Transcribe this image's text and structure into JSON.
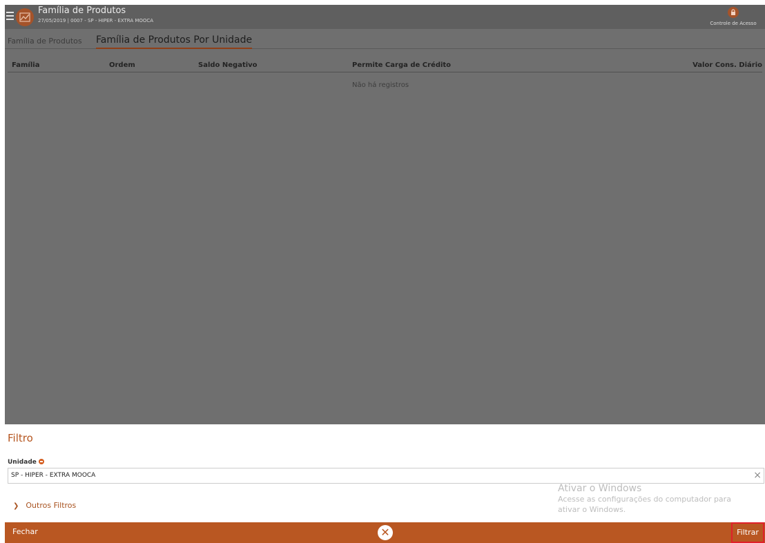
{
  "header": {
    "title": "Família de Produtos",
    "subtitle": "27/05/2019 | 0007 - SP - HIPER - EXTRA MOOCA",
    "access_label": "Controle de Acesso"
  },
  "tabs": [
    {
      "label": "Família de Produtos"
    },
    {
      "label": "Família de Produtos Por Unidade",
      "active": true
    }
  ],
  "table": {
    "columns": [
      "Família",
      "Ordem",
      "Saldo Negativo",
      "Permite Carga de Crédito",
      "Valor Cons. Diário"
    ],
    "empty_message": "Não há registros"
  },
  "filter": {
    "title": "Filtro",
    "unit_label": "Unidade",
    "unit_value": "SP - HIPER - EXTRA MOOCA",
    "clear_symbol": "×",
    "more_filters": "Outros Filtros"
  },
  "watermark": {
    "title": "Ativar o Windows",
    "line1": "Acesse as configurações do computador para",
    "line2": "ativar o Windows."
  },
  "footer": {
    "close_label": "Fechar",
    "filter_label": "Filtrar",
    "x_symbol": "✕"
  },
  "colors": {
    "accent": "#b95722",
    "overlay": "#6f6f6f",
    "highlight": "#e0202a"
  },
  "icons": {
    "menu": "hamburger-menu-icon",
    "app": "chart-icon",
    "access": "lock-icon",
    "required": "required-dot-icon",
    "chevron": "chevron-right-icon",
    "close": "close-icon"
  }
}
